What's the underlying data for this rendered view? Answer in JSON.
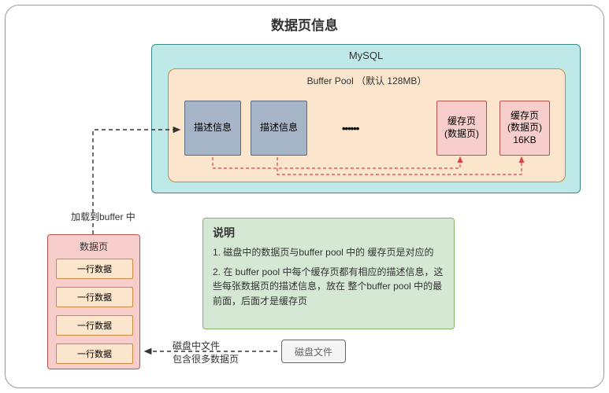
{
  "title": "数据页信息",
  "mysql": {
    "label": "MySQL",
    "buffer_pool": {
      "label": "Buffer Pool （默认 128MB）",
      "desc1": "描述信息",
      "desc2": "描述信息",
      "dots": "••••••",
      "cache1_line1": "缓存页",
      "cache1_line2": "(数据页)",
      "cache2_line1": "缓存页",
      "cache2_line2": "(数据页)",
      "cache2_line3": "16KB"
    }
  },
  "load_label": "加载到buffer 中",
  "datapage": {
    "title": "数据页",
    "rows": [
      "一行数据",
      "一行数据",
      "一行数据",
      "一行数据"
    ]
  },
  "explain": {
    "title": "说明",
    "p1": "1. 磁盘中的数据页与buffer pool 中的 缓存页是对应的",
    "p2": "2. 在 buffer pool 中每个缓存页都有相应的描述信息，这些每张数据页的描述信息，放在 整个buffer pool 中的最前面，后面才是缓存页"
  },
  "disk": {
    "label": "磁盘文件",
    "arrow_label": "磁盘中文件\n包含很多数据页"
  }
}
